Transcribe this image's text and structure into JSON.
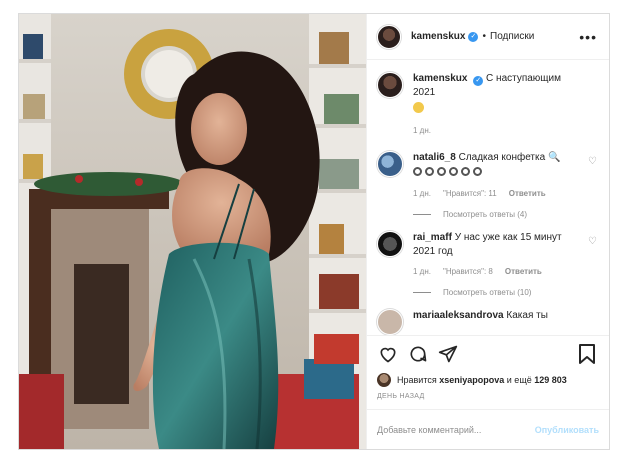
{
  "post": {
    "username": "kamenskux",
    "follow_label": "Подписки",
    "caption_text": "С наступающим 2021",
    "caption_time": "1 дн.",
    "comments": [
      {
        "username": "natali6_8",
        "text": "Сладкая конфетка",
        "time": "1 дн.",
        "likes": "\"Нравится\": 11",
        "reply_label": "Ответить",
        "view_replies": "Посмотреть ответы (4)"
      },
      {
        "username": "rai_maff",
        "text": "У нас уже как 15 минут 2021 год",
        "time": "1 дн.",
        "likes": "\"Нравится\": 8",
        "reply_label": "Ответить",
        "view_replies": "Посмотреть ответы (10)"
      },
      {
        "username": "mariaaleksandrova",
        "text": "Какая ты"
      }
    ],
    "liked_by_prefix": "Нравится",
    "liked_by_user": "xseniyapopova",
    "liked_by_suffix": "и ещё",
    "likes_count": "129 803",
    "date_label": "ДЕНЬ НАЗАД",
    "comment_placeholder": "Добавьте комментарий...",
    "publish_label": "Опубликовать"
  },
  "colors": {
    "verified": "#3897f0",
    "publish_disabled": "#b2dffc",
    "muted": "#8e8e8e"
  },
  "icons": [
    "heart-icon",
    "comment-icon",
    "share-icon",
    "bookmark-icon",
    "more-icon",
    "verified-icon"
  ]
}
